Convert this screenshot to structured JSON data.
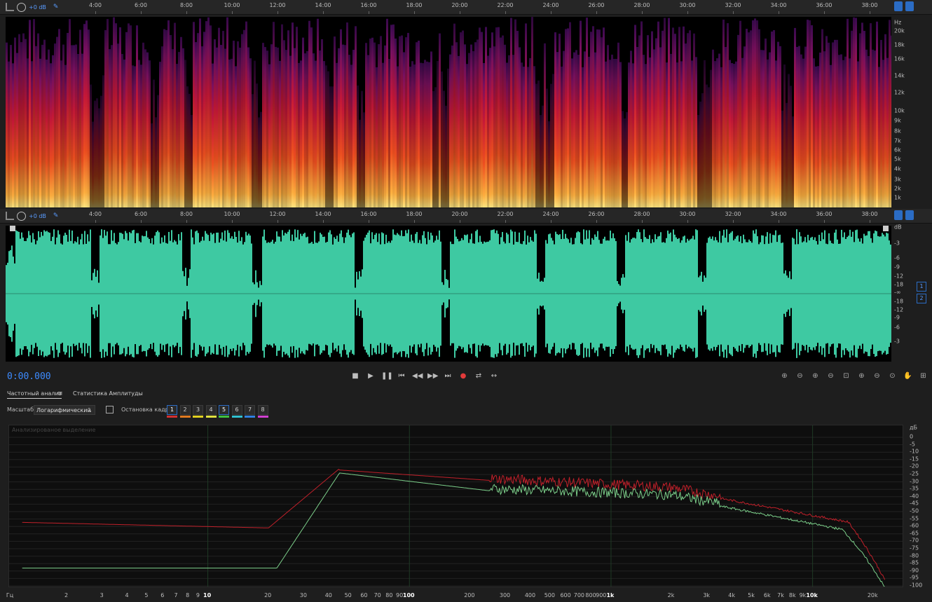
{
  "top_ruler": {
    "db_label": "+0 dB",
    "ticks": [
      "4:00",
      "6:00",
      "8:00",
      "10:00",
      "12:00",
      "14:00",
      "16:00",
      "18:00",
      "20:00",
      "22:00",
      "24:00",
      "26:00",
      "28:00",
      "30:00",
      "32:00",
      "34:00",
      "36:00",
      "38:00"
    ]
  },
  "spectral_axis": {
    "unit": "Hz",
    "labels": [
      "20k",
      "18k",
      "16k",
      "14k",
      "12k",
      "10k",
      "9k",
      "8k",
      "7k",
      "6k",
      "5k",
      "4k",
      "3k",
      "2k",
      "1k"
    ]
  },
  "mid_ruler": {
    "db_label": "+0 dB",
    "ticks": [
      "4:00",
      "6:00",
      "8:00",
      "10:00",
      "12:00",
      "14:00",
      "16:00",
      "18:00",
      "20:00",
      "22:00",
      "24:00",
      "26:00",
      "28:00",
      "30:00",
      "32:00",
      "34:00",
      "36:00",
      "38:00"
    ]
  },
  "wave_axis": {
    "unit": "dB",
    "labels": [
      "-3",
      "-6",
      "-9",
      "-12",
      "-18",
      "-∞",
      "-18",
      "-12",
      "-9",
      "-6",
      "-3"
    ],
    "channels": [
      "1",
      "2"
    ]
  },
  "transport": {
    "time": "0:00.000"
  },
  "panel": {
    "tab_frequency": "Частотный анализ",
    "tab_amplitude": "Статистика Амплитуды",
    "scale_label": "Масштаб:",
    "scale_value": "Логарифмический",
    "freeze_label": "Остановка кадра:",
    "frames": [
      "1",
      "2",
      "3",
      "4",
      "5",
      "6",
      "7",
      "8"
    ],
    "frame_colors": [
      "#d23030",
      "#e07a20",
      "#e0d020",
      "#e0e040",
      "#40c040",
      "#30c0d0",
      "#3080e0",
      "#d040d0"
    ],
    "graph_title": "Анализированое выделение"
  },
  "freq_axis": {
    "unit": "Гц",
    "labels": [
      "2",
      "3",
      "4",
      "5",
      "6",
      "7",
      "8",
      "9",
      "10",
      "20",
      "30",
      "40",
      "50",
      "60",
      "70",
      "80",
      "90",
      "100",
      "200",
      "300",
      "400",
      "500",
      "600",
      "700",
      "800",
      "900",
      "1k",
      "2k",
      "3k",
      "4k",
      "5k",
      "6k",
      "7k",
      "8k",
      "9k",
      "10k",
      "20k"
    ]
  },
  "db_axis": {
    "unit": "дБ",
    "labels": [
      "0",
      "-5",
      "-10",
      "-15",
      "-20",
      "-25",
      "-30",
      "-35",
      "-40",
      "-45",
      "-50",
      "-55",
      "-60",
      "-65",
      "-70",
      "-75",
      "-80",
      "-85",
      "-90",
      "-95",
      "-100"
    ]
  },
  "colors": {
    "accent": "#2b6cc4",
    "waveform": "#3ec9a2",
    "spectrum_red": "#c0202a",
    "spectrum_green": "#7ccf8a",
    "record": "#e23a3a"
  }
}
